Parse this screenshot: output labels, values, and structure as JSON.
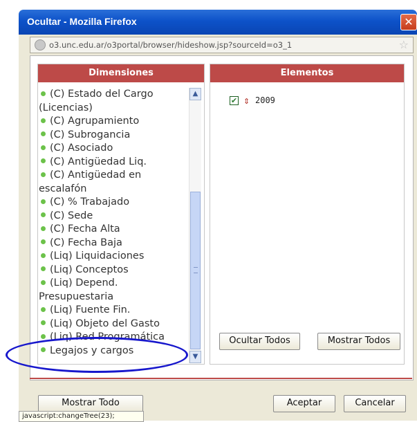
{
  "window": {
    "title": "Ocultar - Mozilla Firefox",
    "close_glyph": "✕"
  },
  "address_bar": {
    "url": "o3.unc.edu.ar/o3portal/browser/hideshow.jsp?sourceId=o3_1",
    "icon": "globe-icon",
    "star_icon": "star-icon"
  },
  "dimensions": {
    "header": "Dimensiones",
    "items": [
      "(C) Estado del Cargo (Licencias)",
      "(C) Agrupamiento",
      "(C) Subrogancia",
      "(C) Asociado",
      "(C) Antigüedad Liq.",
      "(C) Antigüedad en escalafón",
      "(C) % Trabajado",
      "(C) Sede",
      "(C) Fecha Alta",
      "(C) Fecha Baja",
      "(Liq) Liquidaciones",
      "(Liq) Conceptos",
      "(Liq) Depend. Presupuestaria",
      "(Liq) Fuente Fin.",
      "(Liq) Objeto del Gasto",
      "(Liq) Red Programática",
      "Legajos y cargos"
    ]
  },
  "elementos": {
    "header": "Elementos",
    "items": [
      {
        "label": "2009",
        "checked": true
      }
    ]
  },
  "buttons": {
    "ocultar_todos": "Ocultar Todos",
    "mostrar_todos": "Mostrar Todos",
    "mostrar_todo": "Mostrar Todo",
    "aceptar": "Aceptar",
    "cancelar": "Cancelar"
  },
  "status_bar": "javascript:changeTree(23);",
  "colors": {
    "accent": "#bd4a48",
    "bullet": "#6cc24a",
    "annotation": "#1717cc",
    "titlebar": "#0d52c9"
  }
}
